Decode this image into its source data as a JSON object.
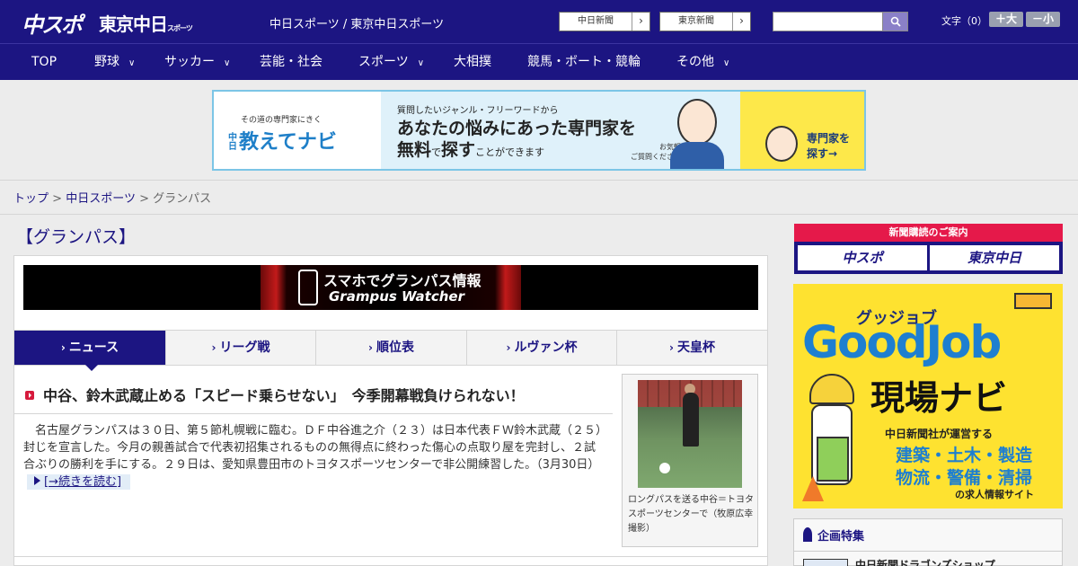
{
  "header": {
    "logo_chuspo": "中スポ",
    "logo_tokyo": "東京中日",
    "logo_tokyo_sub": "スポーツ",
    "site_title": "中日スポーツ / 東京中日スポーツ",
    "links": [
      {
        "label": "中日新聞"
      },
      {
        "label": "東京新聞"
      }
    ],
    "search": {
      "placeholder": "",
      "value": ""
    },
    "font_size_label": "文字（0）",
    "font_larger": "＋大",
    "font_smaller": "－小",
    "arrow": "›"
  },
  "nav": {
    "items": [
      {
        "label": "TOP",
        "chevron": ""
      },
      {
        "label": "野球",
        "chevron": "∨"
      },
      {
        "label": "サッカー",
        "chevron": "∨"
      },
      {
        "label": "芸能・社会",
        "chevron": ""
      },
      {
        "label": "スポーツ",
        "chevron": "∨"
      },
      {
        "label": "大相撲",
        "chevron": ""
      },
      {
        "label": "競馬・ボート・競輪",
        "chevron": ""
      },
      {
        "label": "その他",
        "chevron": "∨"
      }
    ]
  },
  "banner_ad": {
    "tagline": "その道の専門家にきく",
    "brand_prefix": "中日",
    "brand": "教えてナビ",
    "question": "質問したいジャンル・フリーワードから",
    "line1": "あなたの悩みにあった専門家を",
    "line2_bold1": "無料",
    "line2_mid": "で",
    "line2_bold2": "探す",
    "line2_tail": "ことができます",
    "note1": "お気軽に",
    "note2": "ご質問ください！",
    "cta1": "専門家を",
    "cta2": "探す→"
  },
  "breadcrumb": {
    "home": "トップ",
    "sep": ">",
    "section": "中日スポーツ",
    "current": "グランパス"
  },
  "page_title": "【グランパス】",
  "app_banner": {
    "line1": "スマホでグランパス情報",
    "line2": "Grampus Watcher"
  },
  "tabs": [
    {
      "label": "ニュース",
      "active": true
    },
    {
      "label": "リーグ戦",
      "active": false
    },
    {
      "label": "順位表",
      "active": false
    },
    {
      "label": "ルヴァン杯",
      "active": false
    },
    {
      "label": "天皇杯",
      "active": false
    }
  ],
  "tab_marker": "›",
  "article": {
    "title": "中谷、鈴木武蔵止める「スピード乗らせない」　今季開幕戦負けられない！",
    "body": "名古屋グランパスは３０日、第５節札幌戦に臨む。ＤＦ中谷進之介（２３）は日本代表ＦＷ鈴木武蔵（２５）封じを宣言した。今月の親善試合で代表初招集されるものの無得点に終わった傷心の点取り屋を完封し、２試合ぶりの勝利を手にする。２９日は、愛知県豊田市のトヨタスポーツセンターで非公開練習した。",
    "date": "（3月30日）",
    "read_more": "[→続きを読む]",
    "caption": "ロングパスを送る中谷＝トヨタスポーツセンターで（牧原広幸撮影）"
  },
  "sidebar": {
    "subscribe_head": "新聞購読のご案内",
    "subscribe_btn1": "中スポ",
    "subscribe_btn2": "東京中日",
    "goodjob": {
      "kana": "グッジョブ",
      "brand": "GoodJob",
      "navi": "現場ナビ",
      "operator": "中日新聞社が運営する",
      "cats1": "建築・土木・製造",
      "cats2": "物流・警備・清掃",
      "site": "の求人情報サイト"
    },
    "feature_head": "企画特集",
    "feature_item": "中日新聞ドラゴンズショップ"
  },
  "colors": {
    "brand_navy": "#1c1582",
    "accent_red": "#e5194a",
    "goodjob_yellow": "#fee230",
    "ad_border": "#7cc5e6"
  }
}
